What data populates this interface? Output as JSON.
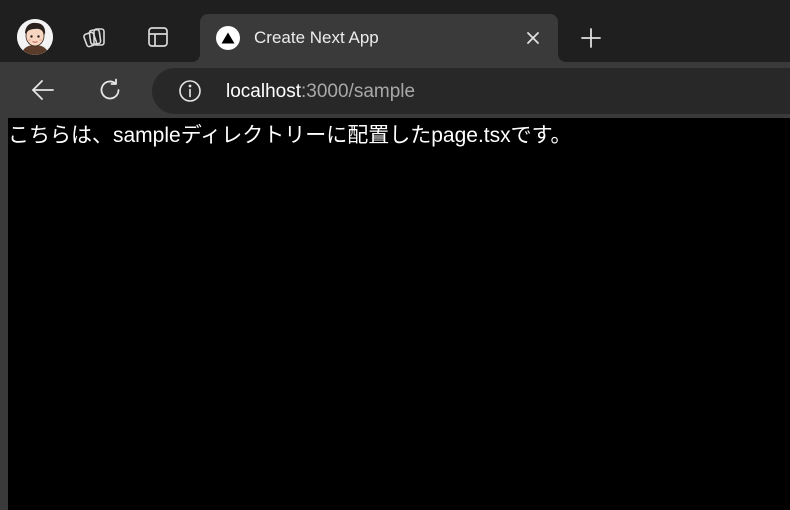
{
  "browser": {
    "tab": {
      "title": "Create Next App",
      "favicon": "nextjs-triangle-icon"
    },
    "address_bar": {
      "host": "localhost",
      "path": ":3000/sample"
    },
    "icons": {
      "profile": "avatar",
      "workspaces": "workspaces-icon",
      "sidebar": "vertical-tabs-icon",
      "close": "close-icon",
      "new_tab": "plus-icon",
      "back": "back-arrow-icon",
      "reload": "reload-icon",
      "info": "info-icon"
    },
    "colors": {
      "tabstrip_bg": "#1f1f1f",
      "active_tab_bg": "#3a3a3a",
      "address_bar_bg": "#282828",
      "page_bg": "#000000",
      "page_text": "#ffffff"
    }
  },
  "page": {
    "text": "こちらは、sampleディレクトリーに配置したpage.tsxです。"
  }
}
